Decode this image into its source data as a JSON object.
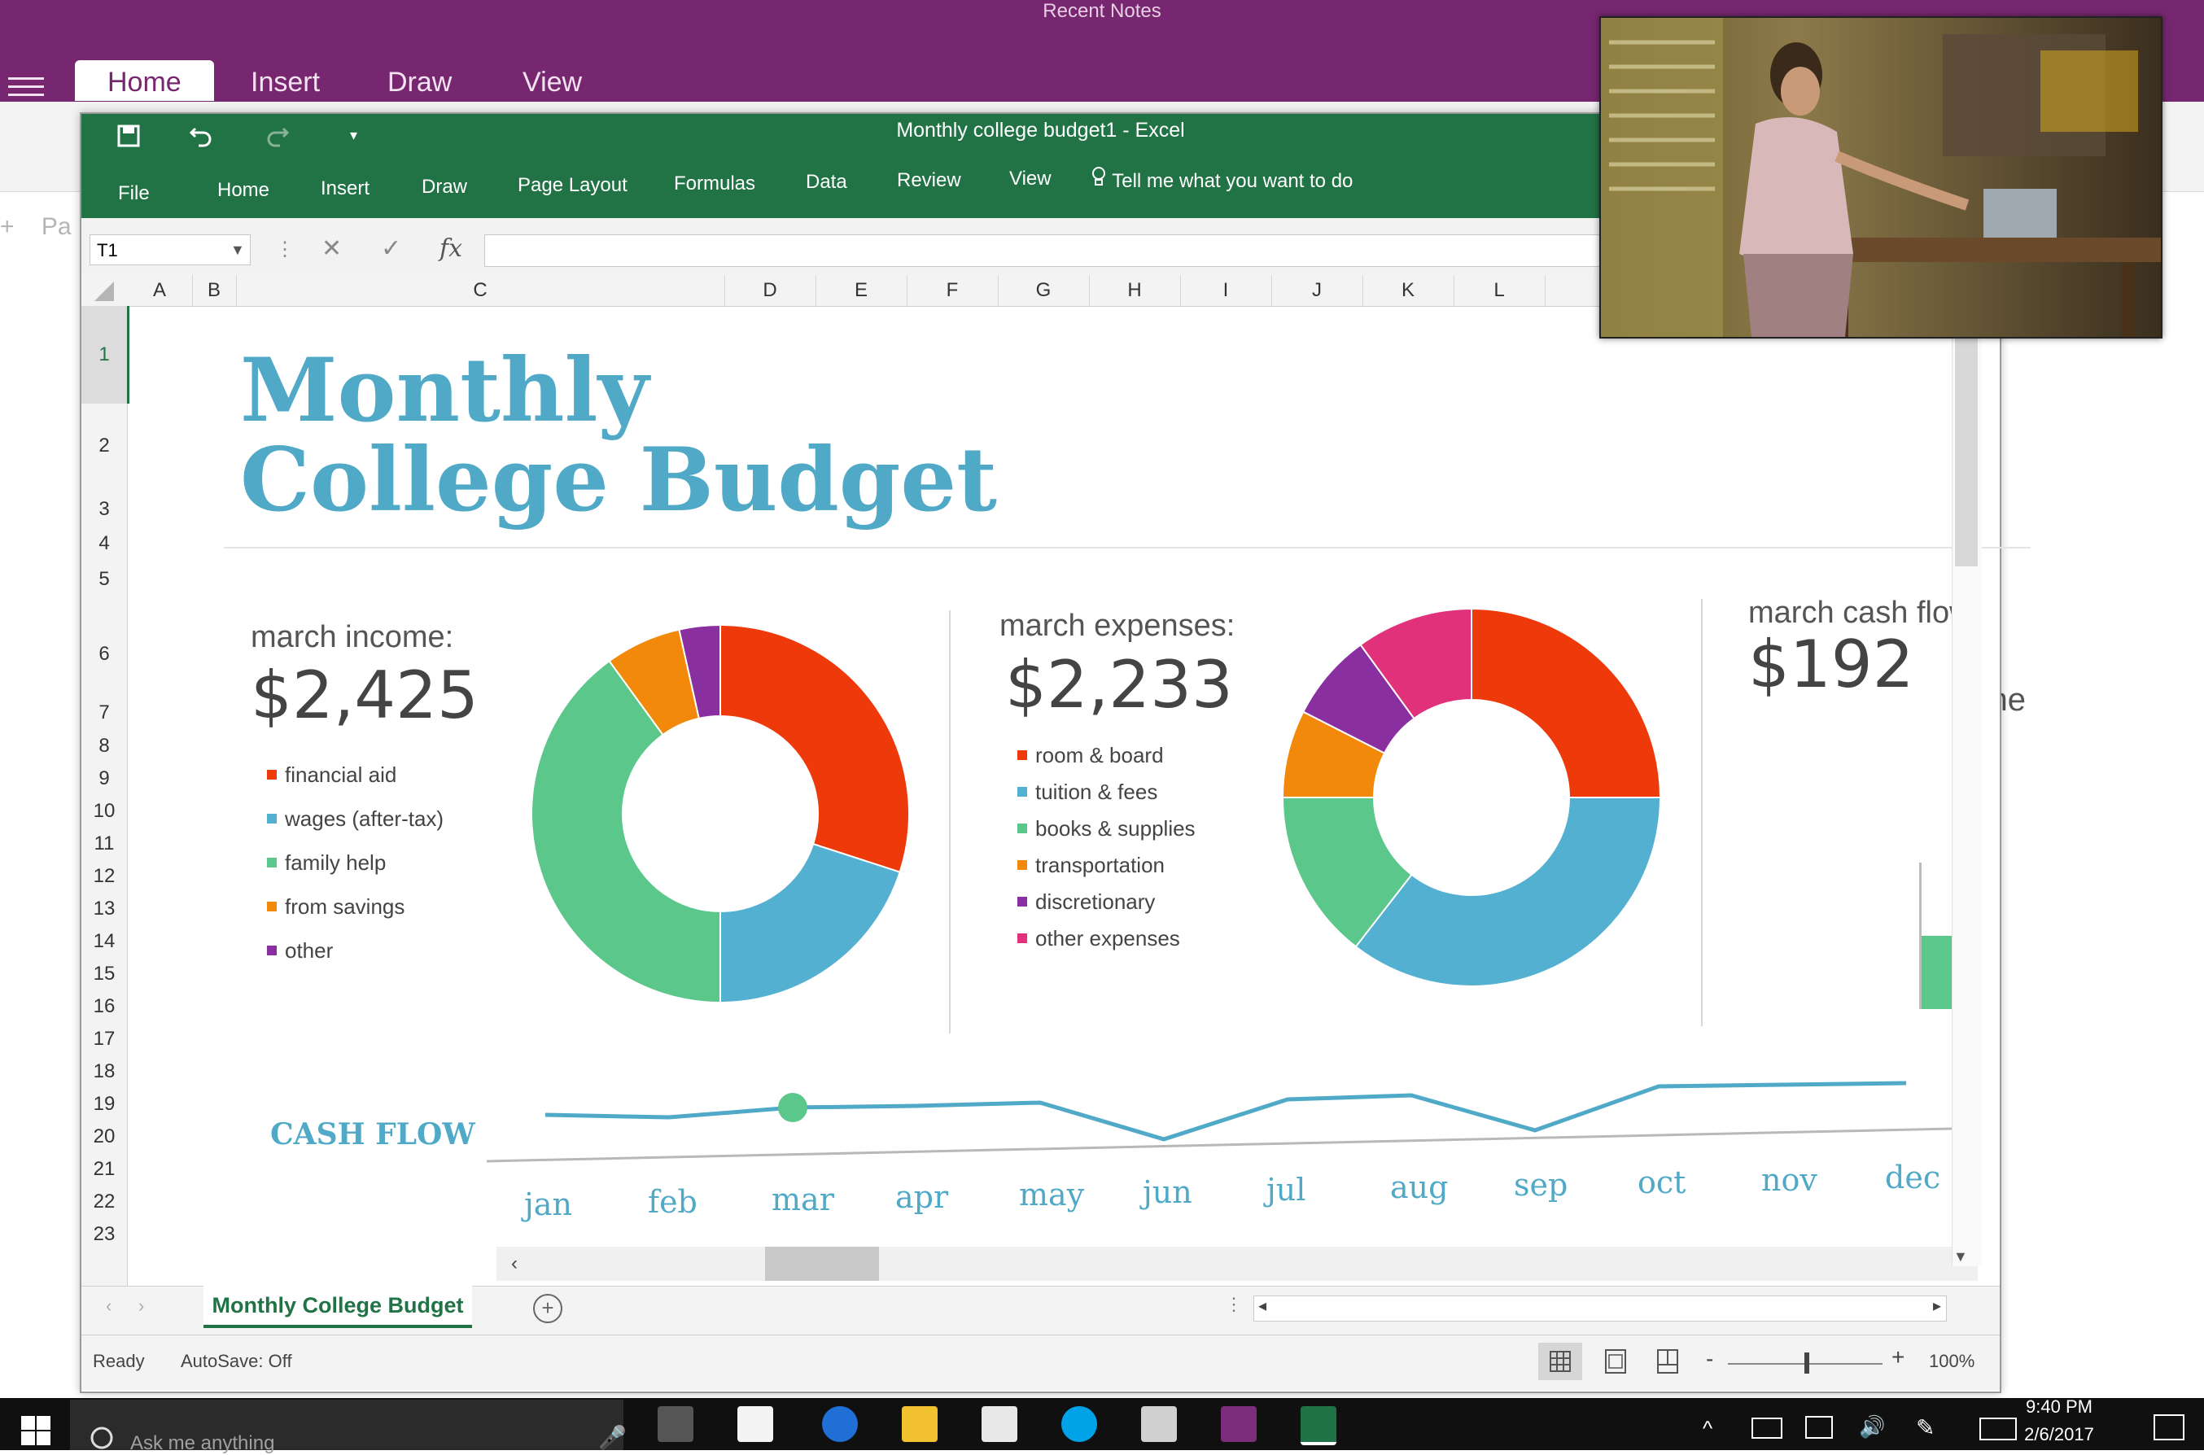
{
  "onenote": {
    "window_title": "Recent Notes",
    "tabs": [
      "Home",
      "Insert",
      "Draw",
      "View"
    ],
    "page_hint": "Pa",
    "body_text_fragment": "n the"
  },
  "excel": {
    "window_title": "Monthly college budget1  -  Excel",
    "tabs": [
      "File",
      "Home",
      "Insert",
      "Draw",
      "Page Layout",
      "Formulas",
      "Data",
      "Review",
      "View"
    ],
    "tell_me": "Tell me what you want to do",
    "name_box": "T1",
    "fx_label": "fx",
    "columns": [
      "A",
      "B",
      "C",
      "D",
      "E",
      "F",
      "G",
      "H",
      "I",
      "J",
      "K",
      "L"
    ],
    "rows": [
      "1",
      "2",
      "3",
      "4",
      "5",
      "6",
      "7",
      "8",
      "9",
      "10",
      "11",
      "12",
      "13",
      "14",
      "15",
      "16",
      "17",
      "18",
      "19",
      "20",
      "21",
      "22",
      "23"
    ],
    "sheet_tab": "Monthly College Budget",
    "status": "Ready",
    "autosave": "AutoSave: Off",
    "zoom": "100%",
    "zoom_minus": "-",
    "zoom_plus": "+"
  },
  "budget": {
    "title_line1": "Monthly",
    "title_line2": "College Budget",
    "income": {
      "label": "march income:",
      "amount": "$2,425",
      "legend": [
        {
          "label": "financial aid",
          "color": "#ee3a0a"
        },
        {
          "label": "wages (after-tax)",
          "color": "#54b0d1"
        },
        {
          "label": "family help",
          "color": "#5bc78a"
        },
        {
          "label": "from savings",
          "color": "#f2890a"
        },
        {
          "label": "other",
          "color": "#8a2fa0"
        }
      ],
      "slices": [
        0.3,
        0.2,
        0.4,
        0.065,
        0.035
      ]
    },
    "expenses": {
      "label": "march expenses:",
      "amount": "$2,233",
      "legend": [
        {
          "label": "room & board",
          "color": "#ee3a0a"
        },
        {
          "label": "tuition & fees",
          "color": "#54b0d1"
        },
        {
          "label": "books & supplies",
          "color": "#5bc78a"
        },
        {
          "label": "transportation",
          "color": "#f2890a"
        },
        {
          "label": "discretionary",
          "color": "#8a2fa0"
        },
        {
          "label": "other expenses",
          "color": "#e0317a"
        }
      ],
      "slices": [
        0.25,
        0.355,
        0.145,
        0.075,
        0.075,
        0.1
      ]
    },
    "cashflow_summary": {
      "label": "march cash flow",
      "amount": "$192"
    },
    "cashflow_label": "CASH FLOW",
    "months": [
      "jan",
      "feb",
      "mar",
      "apr",
      "may",
      "jun",
      "jul",
      "aug",
      "sep",
      "oct",
      "nov",
      "dec"
    ],
    "cashflow_values": [
      0.55,
      0.5,
      0.6,
      0.6,
      0.62,
      0.15,
      0.62,
      0.65,
      0.2,
      0.72,
      0.72,
      0.72
    ],
    "highlight_index": 2
  },
  "taskbar": {
    "search_placeholder": "Ask me anything",
    "time": "9:40 PM",
    "date": "2/6/2017"
  }
}
